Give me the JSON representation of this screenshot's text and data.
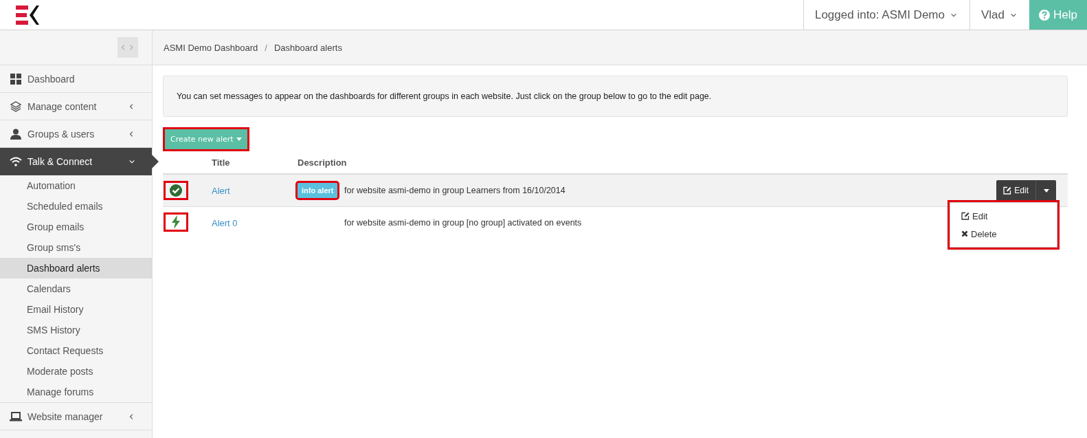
{
  "header": {
    "account_menu": "Logged into: ASMI Demo",
    "user_menu": "Vlad",
    "help_button": "Help"
  },
  "sidebar": {
    "items": [
      {
        "label": "Dashboard",
        "kind": "link"
      },
      {
        "label": "Manage content",
        "kind": "group",
        "expanded": false
      },
      {
        "label": "Groups & users",
        "kind": "group",
        "expanded": false
      },
      {
        "label": "Talk & Connect",
        "kind": "group",
        "expanded": true,
        "children": [
          {
            "label": "Automation",
            "selected": false
          },
          {
            "label": "Scheduled emails",
            "selected": false
          },
          {
            "label": "Group emails",
            "selected": false
          },
          {
            "label": "Group sms's",
            "selected": false
          },
          {
            "label": "Dashboard alerts",
            "selected": true
          },
          {
            "label": "Calendars",
            "selected": false
          },
          {
            "label": "Email History",
            "selected": false
          },
          {
            "label": "SMS History",
            "selected": false
          },
          {
            "label": "Contact Requests",
            "selected": false
          },
          {
            "label": "Moderate posts",
            "selected": false
          },
          {
            "label": "Manage forums",
            "selected": false
          }
        ]
      },
      {
        "label": "Website manager",
        "kind": "group",
        "expanded": false
      }
    ]
  },
  "breadcrumb": {
    "items": [
      "ASMI Demo Dashboard",
      "Dashboard alerts"
    ],
    "separator": "/"
  },
  "info_message": "You can set messages to appear on the dashboards for different groups in each website. Just click on the group below to go to the edit page.",
  "create_button": {
    "label": "Create new alert",
    "highlighted": true
  },
  "table": {
    "columns": [
      "Title",
      "Description"
    ],
    "rows": [
      {
        "kind": "check",
        "icon_highlighted": true,
        "title": "Alert",
        "badge": {
          "label": "info alert",
          "highlighted": true
        },
        "description": "for website asmi-demo in group Learners from 16/10/2014",
        "hovered": true,
        "actions": {
          "edit_label": "Edit",
          "menu": {
            "open": true,
            "highlighted": true,
            "items": [
              {
                "kind": "edit",
                "label": "Edit"
              },
              {
                "kind": "delete",
                "label": "Delete"
              }
            ]
          }
        }
      },
      {
        "kind": "bolt",
        "icon_highlighted": true,
        "title": "Alert 0",
        "description": "for website asmi-demo in group [no group] activated on events",
        "hovered": false
      }
    ]
  }
}
